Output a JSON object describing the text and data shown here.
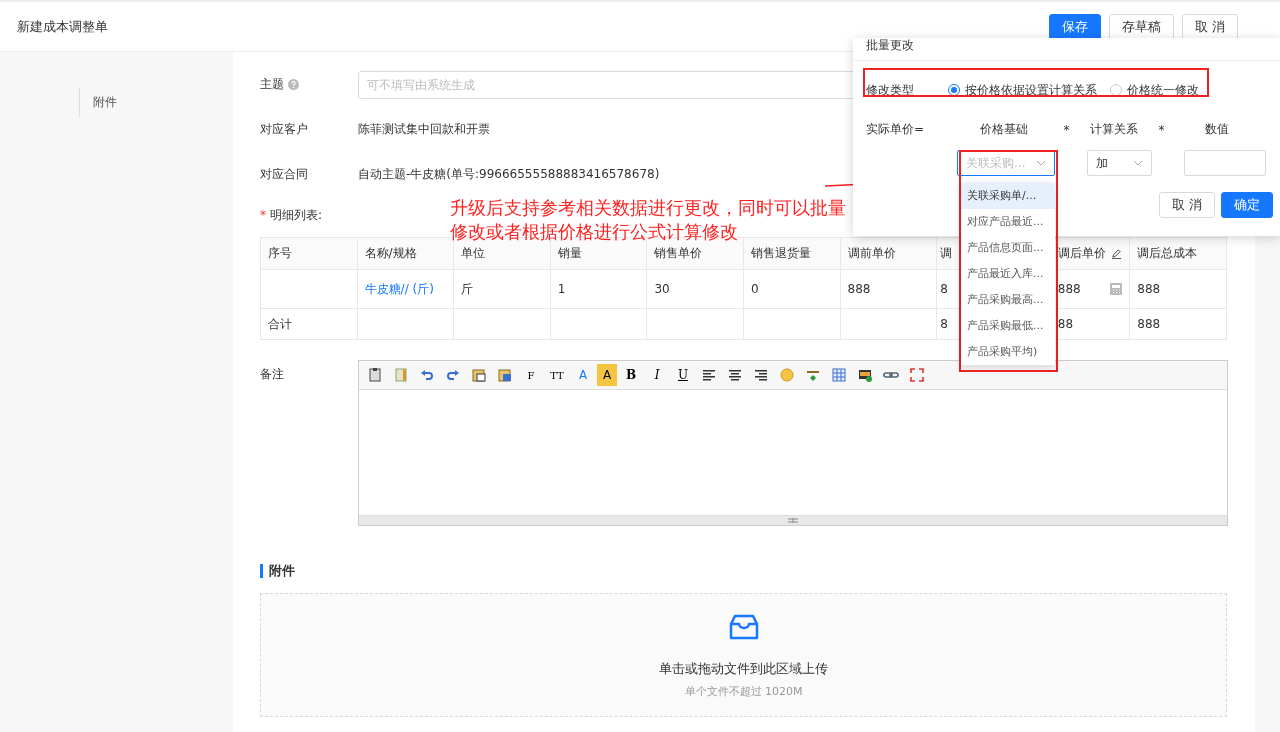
{
  "header": {
    "title": "新建成本调整单",
    "buttons": [
      {
        "label": "保存",
        "kind": "primary"
      },
      {
        "label": "存草稿",
        "kind": "default"
      },
      {
        "label": "取 消",
        "kind": "default"
      }
    ]
  },
  "sidebar": {
    "items": [
      {
        "label": "附件",
        "selected": false
      }
    ]
  },
  "form": {
    "subject": {
      "label": "主题",
      "placeholder": "可不填写由系统生成"
    },
    "fields": [
      {
        "label": "对应客户",
        "value": "陈菲测试集中回款和开票"
      },
      {
        "label": "对应合同",
        "value": "自动主题-牛皮糖(单号:99666555588883416578678)"
      }
    ],
    "detail_label": "明细列表:",
    "required_mark": "*"
  },
  "table": {
    "columns": [
      "序号",
      "名称/规格",
      "单位",
      "销量",
      "销售单价",
      "销售退货量",
      "调前单价",
      "调",
      "调后单价",
      "调后总成本"
    ],
    "rows": [
      [
        "",
        "牛皮糖// (斤)",
        "斤",
        "1",
        "30",
        "0",
        "888",
        "8",
        "888",
        "888"
      ],
      [
        "合计",
        "",
        "",
        "",
        "",
        "",
        "",
        "8",
        "88",
        "888"
      ]
    ]
  },
  "remark": {
    "label": "备注",
    "tools": [
      {
        "kind": "paste"
      },
      {
        "kind": "template"
      },
      {
        "kind": "undo"
      },
      {
        "kind": "redo"
      },
      {
        "kind": "paste-text"
      },
      {
        "kind": "paste-word"
      },
      {
        "kind": "glyph",
        "label": "F"
      },
      {
        "kind": "glyph",
        "label": "TT"
      },
      {
        "kind": "color",
        "label": "A"
      },
      {
        "kind": "highlight",
        "label": "A"
      },
      {
        "kind": "bold",
        "label": "B"
      },
      {
        "kind": "italic",
        "label": "I"
      },
      {
        "kind": "underline",
        "label": "U"
      },
      {
        "kind": "align-left"
      },
      {
        "kind": "align-center"
      },
      {
        "kind": "align-right"
      },
      {
        "kind": "emoji"
      },
      {
        "kind": "rule"
      },
      {
        "kind": "table"
      },
      {
        "kind": "image"
      },
      {
        "kind": "link"
      },
      {
        "kind": "fullscreen"
      }
    ]
  },
  "attachments": {
    "title": "附件",
    "upload_text": "单击或拖动文件到此区域上传",
    "hint": "单个文件不超过 1020M"
  },
  "annotation": {
    "text": "升级后支持参考相关数据进行更改，同时可以批量修改或者根据价格进行公式计算修改"
  },
  "popup": {
    "title": "批量更改",
    "type_label": "修改类型",
    "options": [
      {
        "label": "按价格依据设置计算关系",
        "selected": true
      },
      {
        "label": "价格统一修改",
        "selected": false
      }
    ],
    "formula": [
      "实际单价=",
      "价格基础",
      "*",
      "计算关系",
      "*",
      "数值"
    ],
    "base_select": {
      "placeholder": "关联采购..."
    },
    "op_select": {
      "value": "加"
    },
    "buttons": [
      {
        "label": "取 消",
        "kind": "default"
      },
      {
        "label": "确定",
        "kind": "primary"
      }
    ],
    "dropdown": [
      {
        "label": "关联采购单/...",
        "selected": true
      },
      {
        "label": "对应产品最近...",
        "selected": false
      },
      {
        "label": "产品信息页面...",
        "selected": false
      },
      {
        "label": "产品最近入库...",
        "selected": false
      },
      {
        "label": "产品采购最高...",
        "selected": false
      },
      {
        "label": "产品采购最低...",
        "selected": false
      },
      {
        "label": "产品采购平均)",
        "selected": false
      }
    ]
  }
}
